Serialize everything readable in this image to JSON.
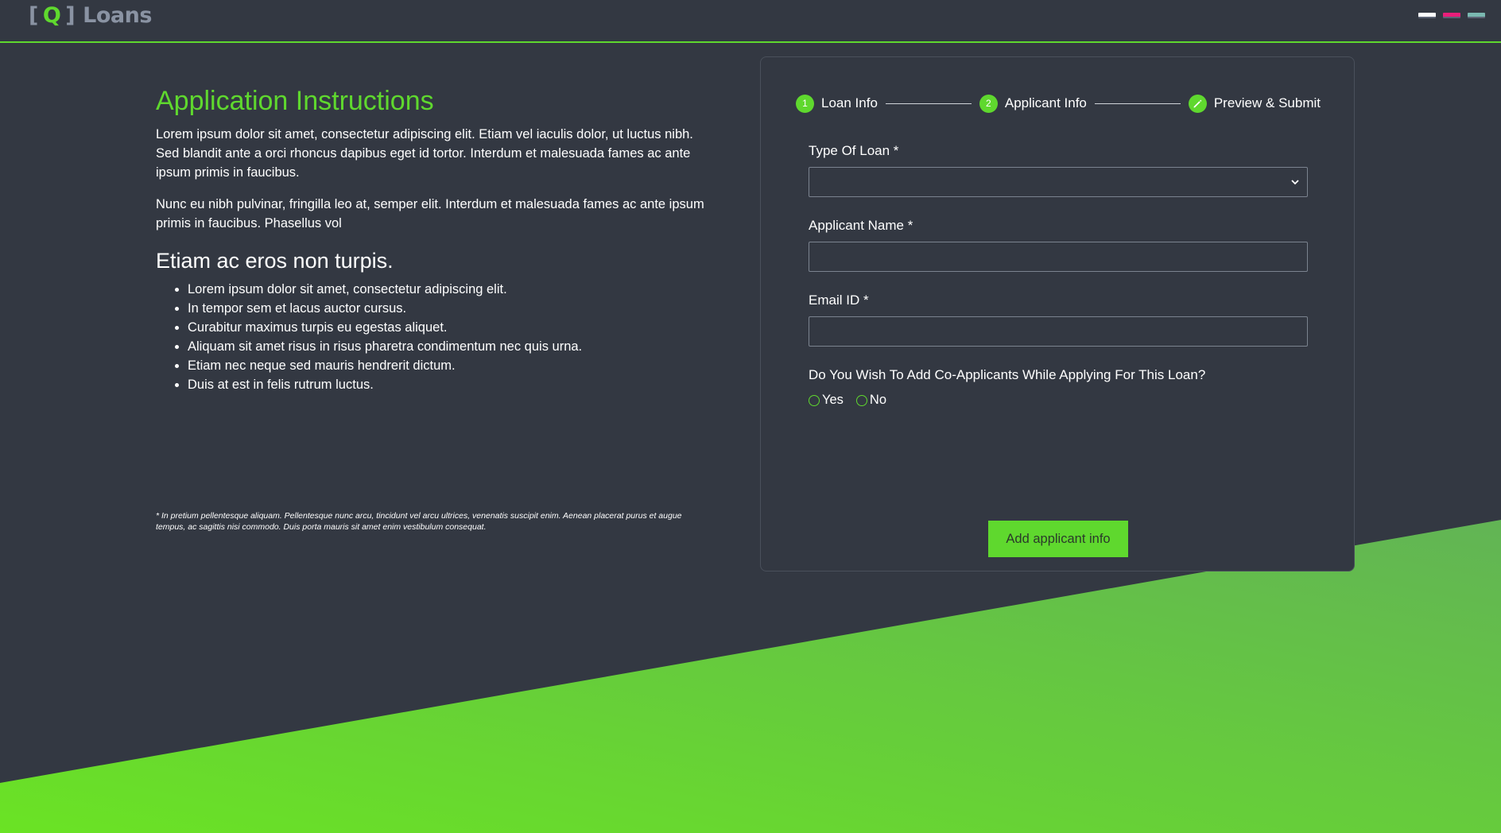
{
  "header": {
    "logo": {
      "bracket_open": "[",
      "letter": "Q",
      "bracket_close": "]",
      "word": "Loans"
    },
    "theme_swatches": [
      {
        "name": "white-theme",
        "color": "#ffffff"
      },
      {
        "name": "pink-theme",
        "color": "#e91e7a"
      },
      {
        "name": "teal-theme",
        "color": "#7ab8b0"
      }
    ]
  },
  "instructions": {
    "title": "Application Instructions",
    "paragraphs": [
      "Lorem ipsum dolor sit amet, consectetur adipiscing elit. Etiam vel iaculis dolor, ut luctus nibh. Sed blandit ante a orci rhoncus dapibus eget id tortor. Interdum et malesuada fames ac ante ipsum primis in faucibus.",
      "Nunc eu nibh pulvinar, fringilla leo at, semper elit. Interdum et malesuada fames ac ante ipsum primis in faucibus. Phasellus vol"
    ],
    "subheading": "Etiam ac eros non turpis.",
    "bullets": [
      "Lorem ipsum dolor sit amet, consectetur adipiscing elit.",
      "In tempor sem et lacus auctor cursus.",
      "Curabitur maximus turpis eu egestas aliquet.",
      "Aliquam sit amet risus in risus pharetra condimentum nec quis urna.",
      "Etiam nec neque sed mauris hendrerit dictum.",
      "Duis at est in felis rutrum luctus."
    ],
    "footnote": "* In pretium pellentesque aliquam. Pellentesque nunc arcu, tincidunt vel arcu ultrices, venenatis suscipit enim. Aenean placerat purus et augue tempus, ac sagittis nisi commodo. Duis porta mauris sit amet enim vestibulum consequat."
  },
  "stepper": {
    "steps": [
      {
        "number": "1",
        "label": "Loan Info"
      },
      {
        "number": "2",
        "label": "Applicant Info"
      },
      {
        "icon": "pencil-icon",
        "label": "Preview & Submit"
      }
    ]
  },
  "form": {
    "loan_type_label": "Type Of Loan *",
    "loan_type_value": "",
    "applicant_name_label": "Applicant Name *",
    "applicant_name_value": "",
    "email_label": "Email ID *",
    "email_value": "",
    "co_applicant_question": "Do You Wish To Add Co-Applicants While Applying For This Loan?",
    "radio_yes": "Yes",
    "radio_no": "No",
    "submit_label": "Add applicant info"
  },
  "colors": {
    "accent": "#5fd82e",
    "background": "#333842",
    "wedge_gradient": [
      "#6ae324",
      "#62b455"
    ]
  }
}
